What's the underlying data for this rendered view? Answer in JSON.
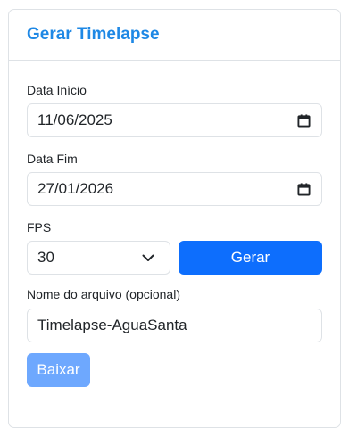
{
  "card": {
    "title": "Gerar Timelapse"
  },
  "form": {
    "start_date": {
      "label": "Data Início",
      "value": "11/06/2025"
    },
    "end_date": {
      "label": "Data Fim",
      "value": "27/01/2026"
    },
    "fps": {
      "label": "FPS",
      "value": "30"
    },
    "generate_label": "Gerar",
    "filename": {
      "label": "Nome do arquivo (opcional)",
      "value": "Timelapse-AguaSanta"
    },
    "download_label": "Baixar"
  },
  "icons": {
    "calendar": "calendar-icon",
    "chevron": "chevron-down-icon"
  },
  "colors": {
    "title": "#1e88e5",
    "primary": "#0d6efd",
    "disabled": "#6ea8fe",
    "border": "#dee2e6"
  }
}
